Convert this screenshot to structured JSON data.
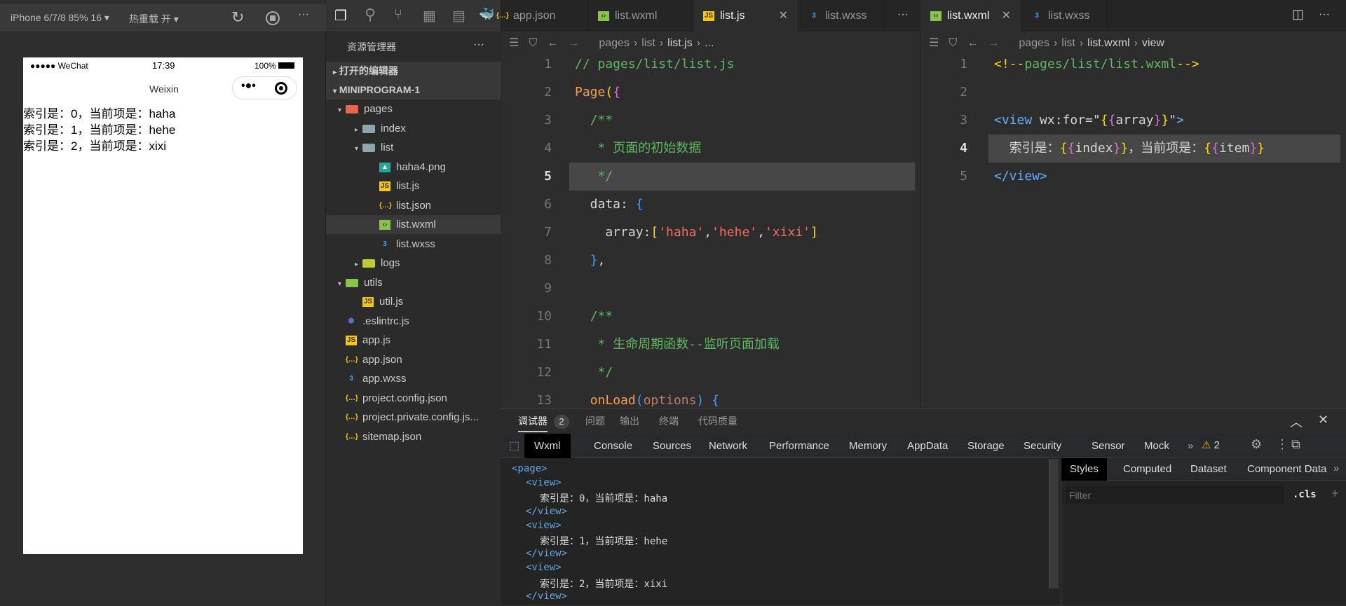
{
  "simulator": {
    "device": "iPhone 6/7/8 85% 16 ▾",
    "hot_reload": "热重载 开 ▾",
    "status": {
      "carrier": "●●●●● WeChat",
      "time": "17:39",
      "battery": "100%"
    },
    "nav_title": "Weixin",
    "lines": [
      "索引是：0，当前项是：haha",
      "索引是：1，当前项是：hehe",
      "索引是：2，当前项是：xixi"
    ]
  },
  "explorer": {
    "title": "资源管理器",
    "more": "···",
    "open_editors": "打开的编辑器",
    "project": "MINIPROGRAM-1",
    "items": [
      {
        "label": "pages",
        "indent": 1,
        "arrow": "▾",
        "icon": "folder-pages",
        "color": "#e8674a"
      },
      {
        "label": "index",
        "indent": 2,
        "arrow": "▸",
        "icon": "folder",
        "color": "#90a4ae"
      },
      {
        "label": "list",
        "indent": 2,
        "arrow": "▾",
        "icon": "folder-open",
        "color": "#90a4ae"
      },
      {
        "label": "haha4.png",
        "indent": 3,
        "arrow": "",
        "icon": "image",
        "color": "#26a69a"
      },
      {
        "label": "list.js",
        "indent": 3,
        "arrow": "",
        "icon": "js",
        "color": "#f5c518"
      },
      {
        "label": "list.json",
        "indent": 3,
        "arrow": "",
        "icon": "json",
        "color": "#f5c518"
      },
      {
        "label": "list.wxml",
        "indent": 3,
        "arrow": "",
        "icon": "wxml",
        "color": "#8bc34a",
        "selected": true
      },
      {
        "label": "list.wxss",
        "indent": 3,
        "arrow": "",
        "icon": "wxss",
        "color": "#42a5f5"
      },
      {
        "label": "logs",
        "indent": 2,
        "arrow": "▸",
        "icon": "folder-logs",
        "color": "#c0ca33"
      },
      {
        "label": "utils",
        "indent": 1,
        "arrow": "▾",
        "icon": "folder-utils",
        "color": "#8bc34a"
      },
      {
        "label": "util.js",
        "indent": 2,
        "arrow": "",
        "icon": "js",
        "color": "#f5c518"
      },
      {
        "label": ".eslintrc.js",
        "indent": 1,
        "arrow": "",
        "icon": "eslint",
        "color": "#5c6bc0"
      },
      {
        "label": "app.js",
        "indent": 1,
        "arrow": "",
        "icon": "js",
        "color": "#f5c518"
      },
      {
        "label": "app.json",
        "indent": 1,
        "arrow": "",
        "icon": "json",
        "color": "#f5c518"
      },
      {
        "label": "app.wxss",
        "indent": 1,
        "arrow": "",
        "icon": "wxss",
        "color": "#42a5f5"
      },
      {
        "label": "project.config.json",
        "indent": 1,
        "arrow": "",
        "icon": "json",
        "color": "#f5c518"
      },
      {
        "label": "project.private.config.js...",
        "indent": 1,
        "arrow": "",
        "icon": "json",
        "color": "#f5c518"
      },
      {
        "label": "sitemap.json",
        "indent": 1,
        "arrow": "",
        "icon": "json",
        "color": "#f5c518"
      }
    ]
  },
  "editor1": {
    "tabs": [
      {
        "label": "app.json",
        "icon": "json"
      },
      {
        "label": "list.wxml",
        "icon": "wxml"
      },
      {
        "label": "list.js",
        "icon": "js",
        "active": true
      },
      {
        "label": "list.wxss",
        "icon": "wxss"
      }
    ],
    "breadcrumb": [
      "pages",
      "list",
      "list.js",
      "..."
    ],
    "current_line": 5,
    "lines": [
      [
        [
          "c-com",
          "// pages/list/list.js"
        ]
      ],
      [
        [
          "c-fn",
          "Page"
        ],
        [
          "c-y",
          "("
        ],
        [
          "c-p",
          "{"
        ]
      ],
      [
        [
          "c-w",
          "  "
        ],
        [
          "c-com",
          "/**"
        ]
      ],
      [
        [
          "c-w",
          "   "
        ],
        [
          "c-com",
          "* 页面的初始数据"
        ]
      ],
      [
        [
          "c-w",
          "   "
        ],
        [
          "c-com",
          "*/"
        ]
      ],
      [
        [
          "c-w",
          "  data: "
        ],
        [
          "c-b",
          "{"
        ]
      ],
      [
        [
          "c-w",
          "    array:"
        ],
        [
          "c-y",
          "["
        ],
        [
          "c-s",
          "'haha'"
        ],
        [
          "c-w",
          ","
        ],
        [
          "c-s",
          "'hehe'"
        ],
        [
          "c-w",
          ","
        ],
        [
          "c-s",
          "'xixi'"
        ],
        [
          "c-y",
          "]"
        ]
      ],
      [
        [
          "c-w",
          "  "
        ],
        [
          "c-b",
          "}"
        ],
        [
          "c-w",
          ","
        ]
      ],
      [],
      [
        [
          "c-w",
          "  "
        ],
        [
          "c-com",
          "/**"
        ]
      ],
      [
        [
          "c-w",
          "   "
        ],
        [
          "c-com",
          "* 生命周期函数--监听页面加载"
        ]
      ],
      [
        [
          "c-w",
          "   "
        ],
        [
          "c-com",
          "*/"
        ]
      ],
      [
        [
          "c-w",
          "  "
        ],
        [
          "c-fn",
          "onLoad"
        ],
        [
          "c-b",
          "("
        ],
        [
          "c-arg",
          "options"
        ],
        [
          "c-b",
          ")"
        ],
        [
          "c-w",
          " "
        ],
        [
          "c-b",
          "{"
        ]
      ]
    ]
  },
  "editor2": {
    "tabs": [
      {
        "label": "list.wxml",
        "icon": "wxml",
        "active": true
      },
      {
        "label": "list.wxss",
        "icon": "wxss"
      }
    ],
    "breadcrumb": [
      "pages",
      "list",
      "list.wxml",
      "view"
    ],
    "current_line": 4,
    "lines": [
      [
        [
          "c-y",
          "<!--"
        ],
        [
          "c-com",
          "pages/list/list.wxml"
        ],
        [
          "c-y",
          "-->"
        ]
      ],
      [],
      [
        [
          "c-tag",
          "<view"
        ],
        [
          "c-w",
          " wx:for="
        ],
        [
          "c-w",
          "\""
        ],
        [
          "c-y",
          "{"
        ],
        [
          "c-p",
          "{"
        ],
        [
          "c-w",
          "array"
        ],
        [
          "c-p",
          "}"
        ],
        [
          "c-y",
          "}"
        ],
        [
          "c-w",
          "\""
        ],
        [
          "c-tag",
          ">"
        ]
      ],
      [
        [
          "c-w",
          "  索引是："
        ],
        [
          "c-y",
          "{"
        ],
        [
          "c-p",
          "{"
        ],
        [
          "c-w",
          "index"
        ],
        [
          "c-p",
          "}"
        ],
        [
          "c-y",
          "}"
        ],
        [
          "c-w",
          "，当前项是："
        ],
        [
          "c-y",
          "{"
        ],
        [
          "c-p",
          "{"
        ],
        [
          "c-w",
          "item"
        ],
        [
          "c-p",
          "}"
        ],
        [
          "c-y",
          "}"
        ]
      ],
      [
        [
          "c-tag",
          "</view>"
        ]
      ]
    ]
  },
  "debugger": {
    "panel_tabs": [
      "调试器",
      "问题",
      "输出",
      "终端",
      "代码质量"
    ],
    "badge": "2",
    "devtools_tabs": [
      "Wxml",
      "Console",
      "Sources",
      "Network",
      "Performance",
      "Memory",
      "AppData",
      "Storage",
      "Security",
      "Sensor",
      "Mock"
    ],
    "more": "»",
    "warnings": "2",
    "wxml": [
      {
        "t": "<page>",
        "tag": true,
        "i": 0
      },
      {
        "t": "<view>",
        "tag": true,
        "i": 1
      },
      {
        "t": "索引是：0，当前项是：haha",
        "tag": false,
        "i": 2
      },
      {
        "t": "</view>",
        "tag": true,
        "i": 1
      },
      {
        "t": "<view>",
        "tag": true,
        "i": 1
      },
      {
        "t": "索引是：1，当前项是：hehe",
        "tag": false,
        "i": 2
      },
      {
        "t": "</view>",
        "tag": true,
        "i": 1
      },
      {
        "t": "<view>",
        "tag": true,
        "i": 1
      },
      {
        "t": "索引是：2，当前项是：xixi",
        "tag": false,
        "i": 2
      },
      {
        "t": "</view>",
        "tag": true,
        "i": 1
      }
    ],
    "styles_tabs": [
      "Styles",
      "Computed",
      "Dataset",
      "Component Data"
    ],
    "filter_placeholder": "Filter",
    "cls": ".cls",
    "plus": "+"
  }
}
